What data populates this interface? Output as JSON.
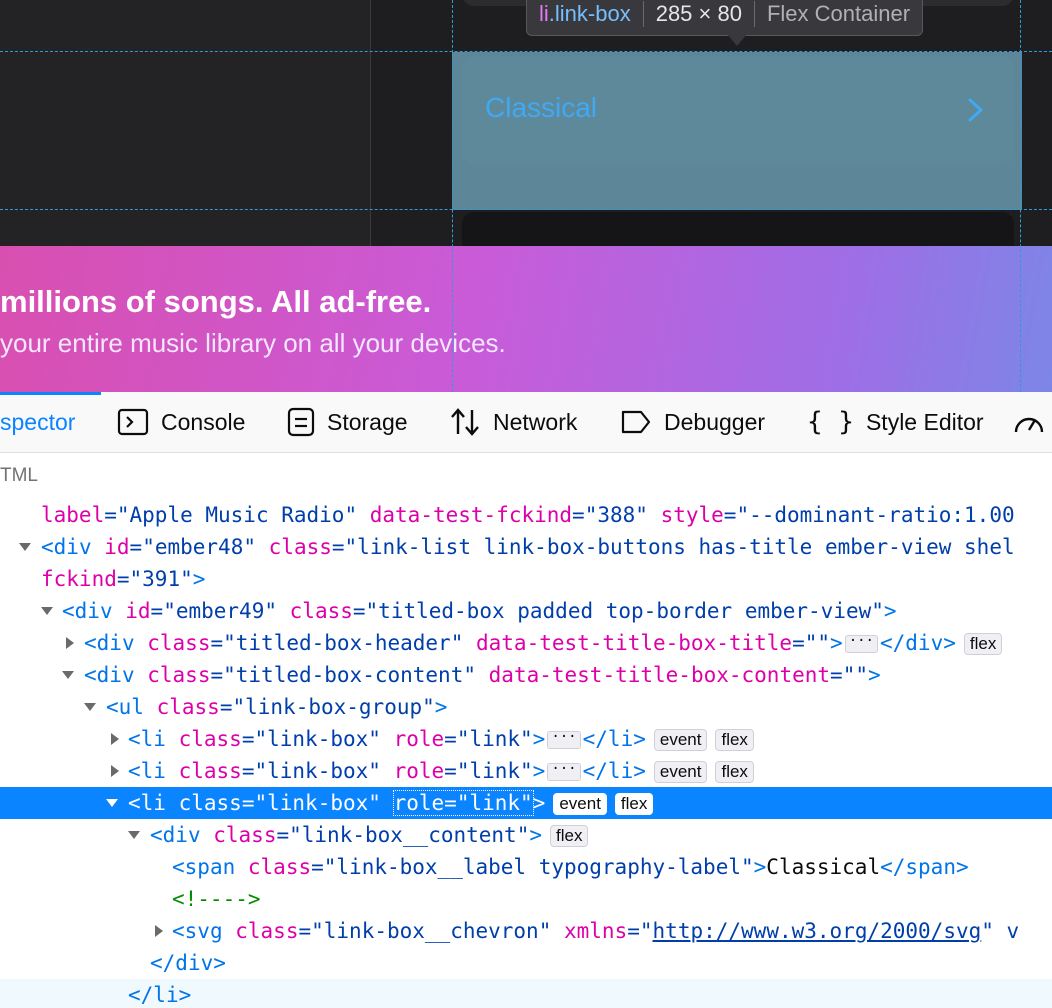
{
  "page": {
    "tooltip": {
      "tag": "li",
      "class": ".link-box",
      "dims": "285 × 80",
      "type": "Flex Container"
    },
    "link_box_label": "Classical",
    "banner": {
      "headline": "millions of songs. All ad-free.",
      "subline": "your entire music library on all your devices."
    }
  },
  "toolbar": {
    "tabs": [
      {
        "label": "spector",
        "icon": "inspector-icon"
      },
      {
        "label": "Console",
        "icon": "console-icon"
      },
      {
        "label": "Storage",
        "icon": "storage-icon"
      },
      {
        "label": "Network",
        "icon": "network-icon"
      },
      {
        "label": "Debugger",
        "icon": "debugger-icon"
      },
      {
        "label": "Style Editor",
        "icon": "braces-icon"
      },
      {
        "label": "",
        "icon": "performance-icon"
      }
    ]
  },
  "breadcrumb": {
    "label": "TML"
  },
  "tree": {
    "r0": {
      "a1n": "label",
      "a1v": "\"Apple Music Radio\"",
      "a2n": "data-test-fckind",
      "a2v": "\"388\"",
      "a3n": "style",
      "a3v": "\"--dominant-ratio:1.00"
    },
    "r1": {
      "tag": "div",
      "a1n": "id",
      "a1v": "\"ember48\"",
      "a2n": "class",
      "a2v": "\"link-list link-box-buttons has-title ember-view shel"
    },
    "r2": {
      "a1n": "fckind",
      "a1v": "\"391\""
    },
    "r3": {
      "tag": "div",
      "a1n": "id",
      "a1v": "\"ember49\"",
      "a2n": "class",
      "a2v": "\"titled-box padded top-border ember-view\""
    },
    "r4": {
      "tag": "div",
      "a1n": "class",
      "a1v": "\"titled-box-header\"",
      "a2n": "data-test-title-box-title",
      "a2v": "\"\"",
      "end": "div",
      "badge": "flex"
    },
    "r5": {
      "tag": "div",
      "a1n": "class",
      "a1v": "\"titled-box-content\"",
      "a2n": "data-test-title-box-content",
      "a2v": "\"\""
    },
    "r6": {
      "tag": "ul",
      "a1n": "class",
      "a1v": "\"link-box-group\""
    },
    "r7": {
      "tag": "li",
      "a1n": "class",
      "a1v": "\"link-box\"",
      "a2n": "role",
      "a2v": "\"link\"",
      "end": "li",
      "b1": "event",
      "b2": "flex"
    },
    "r8": {
      "tag": "li",
      "a1n": "class",
      "a1v": "\"link-box\"",
      "a2n": "role",
      "a2v": "\"link\"",
      "end": "li",
      "b1": "event",
      "b2": "flex"
    },
    "r9": {
      "tag": "li",
      "a1n": "class",
      "a1v": "\"link-box\"",
      "a2n": "role",
      "a2v": "\"link\"",
      "b1": "event",
      "b2": "flex"
    },
    "r10": {
      "tag": "div",
      "a1n": "class",
      "a1v": "\"link-box__content\"",
      "b1": "flex"
    },
    "r11": {
      "tag": "span",
      "a1n": "class",
      "a1v": "\"link-box__label typography-label\"",
      "text": "Classical",
      "end": "span"
    },
    "r12": {
      "comment": "<!---->"
    },
    "r13": {
      "tag": "svg",
      "a1n": "class",
      "a1v": "\"link-box__chevron\"",
      "a2n": "xmlns",
      "a2v": "\"",
      "link": "http://www.w3.org/2000/svg",
      "tail": "\" v"
    },
    "r14": {
      "end": "div"
    },
    "r15": {
      "end": "li"
    }
  }
}
